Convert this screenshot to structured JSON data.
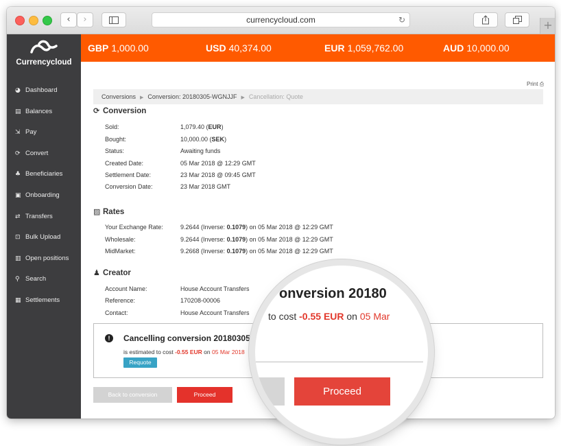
{
  "browser": {
    "url": "currencycloud.com"
  },
  "brand": {
    "name": "Currencycloud",
    "accent_color": "#ff5a00"
  },
  "sidebar": {
    "items": [
      {
        "label": "Dashboard",
        "icon": "dashboard-icon"
      },
      {
        "label": "Balances",
        "icon": "balances-icon"
      },
      {
        "label": "Pay",
        "icon": "pay-icon"
      },
      {
        "label": "Convert",
        "icon": "convert-icon"
      },
      {
        "label": "Beneficiaries",
        "icon": "beneficiaries-icon"
      },
      {
        "label": "Onboarding",
        "icon": "onboarding-icon"
      },
      {
        "label": "Transfers",
        "icon": "transfers-icon"
      },
      {
        "label": "Bulk Upload",
        "icon": "bulk-upload-icon"
      },
      {
        "label": "Open positions",
        "icon": "open-positions-icon"
      },
      {
        "label": "Search",
        "icon": "search-icon"
      },
      {
        "label": "Settlements",
        "icon": "settlements-icon"
      }
    ]
  },
  "balances": [
    {
      "currency": "GBP",
      "amount": "1,000.00"
    },
    {
      "currency": "USD",
      "amount": "40,374.00"
    },
    {
      "currency": "EUR",
      "amount": "1,059,762.00"
    },
    {
      "currency": "AUD",
      "amount": "10,000.00"
    }
  ],
  "print_label": "Print",
  "breadcrumb": {
    "items": [
      "Conversions",
      "Conversion: 20180305-WGNJJF"
    ],
    "current": "Cancellation: Quote"
  },
  "conversion": {
    "title": "Conversion",
    "rows": [
      {
        "label": "Sold:",
        "value": "1,079.40",
        "bold": "EUR"
      },
      {
        "label": "Bought:",
        "value": "10,000.00",
        "bold": "SEK"
      },
      {
        "label": "Status:",
        "value": "Awaiting funds"
      },
      {
        "label": "Created Date:",
        "value": "05 Mar 2018 @ 12:29 GMT"
      },
      {
        "label": "Settlement Date:",
        "value": "23 Mar 2018 @ 09:45 GMT"
      },
      {
        "label": "Conversion Date:",
        "value": "23 Mar 2018 GMT"
      }
    ]
  },
  "rates": {
    "title": "Rates",
    "rows": [
      {
        "label": "Your Exchange Rate:",
        "rate": "9.2644",
        "inverse": "0.1079",
        "when": "05 Mar 2018 @ 12:29 GMT"
      },
      {
        "label": "Wholesale:",
        "rate": "9.2644",
        "inverse": "0.1079",
        "when": "05 Mar 2018 @ 12:29 GMT"
      },
      {
        "label": "MidMarket:",
        "rate": "9.2668",
        "inverse": "0.1079",
        "when": "05 Mar 2018 @ 12:29 GMT"
      }
    ],
    "inverse_prefix": "(Inverse: ",
    "on_word": ") on "
  },
  "creator": {
    "title": "Creator",
    "rows": [
      {
        "label": "Account Name:",
        "value": "House Account Transfers"
      },
      {
        "label": "Reference:",
        "value": "170208-00006"
      },
      {
        "label": "Contact:",
        "value": "House Account Transfers"
      }
    ]
  },
  "cancellation": {
    "title": "Cancelling conversion 20180305-W",
    "prefix": "is estimated to cost ",
    "cost": "-0.55 EUR",
    "on_word": " on ",
    "date": "05 Mar 2018",
    "requote_label": "Requote"
  },
  "actions": {
    "back_label": "Back to conversion",
    "proceed_label": "Proceed"
  },
  "magnifier": {
    "title": "onversion 20180",
    "prefix": "to cost ",
    "cost": "-0.55 EUR",
    "on_word": " on ",
    "date": "05 Mar",
    "proceed_label": "Proceed"
  }
}
